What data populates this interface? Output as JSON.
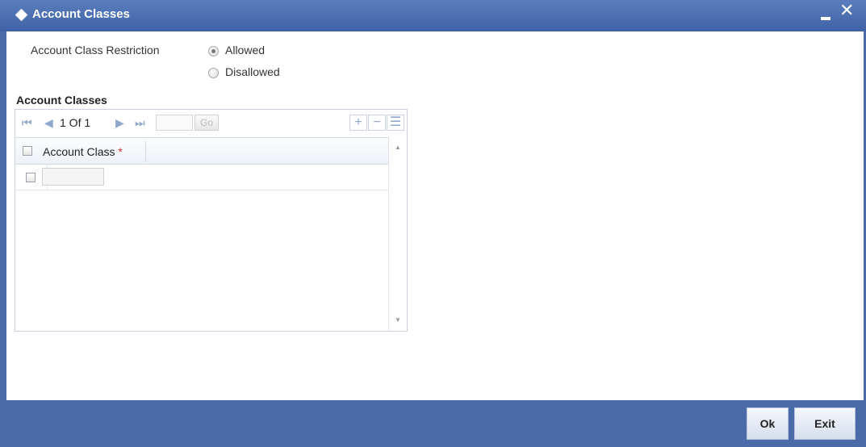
{
  "window": {
    "title": "Account Classes",
    "minimize_glyph": "_",
    "close_glyph": "✕"
  },
  "restriction": {
    "label": "Account Class Restriction",
    "options": [
      {
        "label": "Allowed",
        "selected": true
      },
      {
        "label": "Disallowed",
        "selected": false
      }
    ]
  },
  "grid": {
    "section_title": "Account Classes",
    "pager": {
      "first_icon": "first-page-icon",
      "prev_icon": "prev-page-icon",
      "page_text": "1 Of 1",
      "next_icon": "next-page-icon",
      "last_icon": "last-page-icon",
      "page_input": "",
      "go_label": "Go",
      "add_icon": "plus-icon",
      "delete_icon": "minus-icon",
      "view_icon": "list-icon"
    },
    "columns": [
      {
        "label": "Account Class",
        "required_marker": "*"
      }
    ],
    "rows": [
      {
        "account_class": ""
      }
    ]
  },
  "footer": {
    "ok_label": "Ok",
    "exit_label": "Exit"
  },
  "colors": {
    "titlebar": "#4a6aa8",
    "footer": "#4a6aa8",
    "required": "#d83030"
  }
}
